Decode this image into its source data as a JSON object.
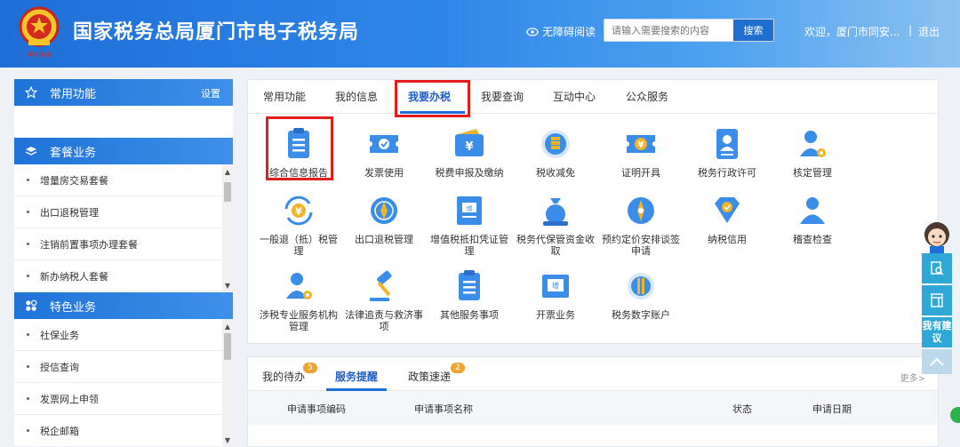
{
  "header": {
    "title": "国家税务总局厦门市电子税务局",
    "logo_signature": "乘风破浪",
    "accessibility": "无障碍阅读",
    "search": {
      "placeholder": "请输入需要搜索的内容",
      "button": "搜索"
    },
    "welcome": "欢迎，厦门市同安...",
    "separator": "|",
    "logout": "退出"
  },
  "sidebar": {
    "common": {
      "title": "常用功能",
      "setting": "设置"
    },
    "package": {
      "title": "套餐业务",
      "items": [
        "增量房交易套餐",
        "出口退税管理",
        "注销前置事项办理套餐",
        "新办纳税人套餐"
      ]
    },
    "special": {
      "title": "特色业务",
      "items": [
        "社保业务",
        "授信查询",
        "发票网上申领",
        "税企邮箱"
      ]
    }
  },
  "main": {
    "tabs": [
      "常用功能",
      "我的信息",
      "我要办税",
      "我要查询",
      "互动中心",
      "公众服务"
    ],
    "active_tab": "我要办税",
    "items": [
      {
        "label": "综合信息报告",
        "icon": "clipboard-icon"
      },
      {
        "label": "发票使用",
        "icon": "invoice-ticket-icon"
      },
      {
        "label": "税费申报及缴纳",
        "icon": "wallet-yuan-icon"
      },
      {
        "label": "税收减免",
        "icon": "coin-stack-icon"
      },
      {
        "label": "证明开具",
        "icon": "yuan-ticket-icon"
      },
      {
        "label": "税务行政许可",
        "icon": "id-card-icon"
      },
      {
        "label": "核定管理",
        "icon": "user-gear-icon"
      },
      {
        "label": "一般退（抵）税管理",
        "icon": "yuan-refresh-icon"
      },
      {
        "label": "出口退税管理",
        "icon": "globe-icon"
      },
      {
        "label": "增值税抵扣凭证管理",
        "icon": "vat-document-icon"
      },
      {
        "label": "税务代保管资金收取",
        "icon": "money-bag-icon"
      },
      {
        "label": "预约定价安排谈签申请",
        "icon": "compass-icon"
      },
      {
        "label": "纳税信用",
        "icon": "diamond-check-icon"
      },
      {
        "label": "稽查检查",
        "icon": "user-icon"
      },
      {
        "label": "涉税专业服务机构管理",
        "icon": "agent-gear-icon"
      },
      {
        "label": "法律追责与救济事项",
        "icon": "gavel-icon"
      },
      {
        "label": "其他服务事项",
        "icon": "document-list-icon"
      },
      {
        "label": "开票业务",
        "icon": "vat-invoice-icon"
      },
      {
        "label": "税务数字账户",
        "icon": "digital-account-icon"
      }
    ]
  },
  "bottom": {
    "tabs": [
      {
        "label": "我的待办",
        "badge": "5"
      },
      {
        "label": "服务提醒",
        "badge": ""
      },
      {
        "label": "政策速递",
        "badge": "2"
      }
    ],
    "more": "更多>",
    "columns": [
      "申请事项编码",
      "申请事项名称",
      "状态",
      "申请日期"
    ]
  },
  "float": {
    "suggest": "我有建议"
  },
  "colors": {
    "primary": "#1e6fd6",
    "highlight": "#e31c1c",
    "badge": "#f0a22e",
    "float": "#2fa8d8"
  }
}
